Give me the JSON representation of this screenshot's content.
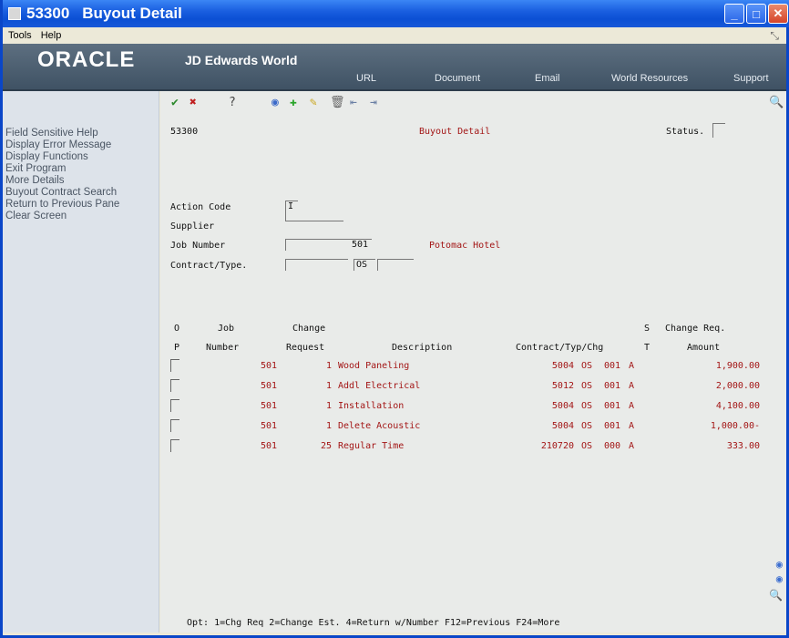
{
  "window": {
    "code": "53300",
    "title": "Buyout Detail",
    "buttons": {
      "minimize": "_",
      "maximize": "□",
      "close": "✕"
    }
  },
  "menu": {
    "tools": "Tools",
    "help": "Help"
  },
  "banner": {
    "logo": "ORACLE",
    "product": "JD Edwards World",
    "links": [
      "URL",
      "Document",
      "Email",
      "World Resources",
      "Support"
    ]
  },
  "left_panel": {
    "items": [
      "Field Sensitive Help",
      "Display Error Message",
      "Display Functions",
      "Exit Program",
      "More Details",
      "Buyout Contract Search",
      "Return to Previous Pane",
      "Clear Screen"
    ]
  },
  "toolbar": {
    "icons": [
      "ok-icon",
      "cancel-icon",
      "help-icon",
      "inquire-icon",
      "add-icon",
      "change-icon",
      "delete-icon",
      "previous-icon",
      "next-icon",
      "search-icon"
    ]
  },
  "form": {
    "program_id": "53300",
    "form_title": "Buyout Detail",
    "status_label": "Status.",
    "status_value": "",
    "action_code_label": "Action Code",
    "action_code_value": "I",
    "supplier_label": "Supplier",
    "supplier_value": "",
    "job_number_label": "Job Number",
    "job_number_value": "501",
    "job_name": "Potomac Hotel",
    "contract_type_label": "Contract/Type.",
    "contract_value": "",
    "type_value": "OS",
    "change_value": ""
  },
  "table": {
    "headers": {
      "op1": "O",
      "op2": "P",
      "job1": "Job",
      "job2": "Number",
      "chg1": "Change",
      "chg2": "Request",
      "desc": "Description",
      "contract": "Contract/Typ/Chg",
      "st1": "S",
      "st2": "T",
      "amt1": "Change Req.",
      "amt2": "Amount"
    },
    "rows": [
      {
        "job": "501",
        "change": "1",
        "description": "Wood Paneling",
        "contract": "5004",
        "typ": "OS",
        "chg": "001",
        "status": "A",
        "amount": "1,900.00"
      },
      {
        "job": "501",
        "change": "1",
        "description": "Addl Electrical",
        "contract": "5012",
        "typ": "OS",
        "chg": "001",
        "status": "A",
        "amount": "2,000.00"
      },
      {
        "job": "501",
        "change": "1",
        "description": "Installation",
        "contract": "5004",
        "typ": "OS",
        "chg": "001",
        "status": "A",
        "amount": "4,100.00"
      },
      {
        "job": "501",
        "change": "1",
        "description": "Delete Acoustic",
        "contract": "5004",
        "typ": "OS",
        "chg": "001",
        "status": "A",
        "amount": "1,000.00-"
      },
      {
        "job": "501",
        "change": "25",
        "description": "Regular Time",
        "contract": "210720",
        "typ": "OS",
        "chg": "000",
        "status": "A",
        "amount": "333.00"
      }
    ]
  },
  "footer": {
    "text": "Opt:  1=Chg Req  2=Change Est.  4=Return w/Number   F12=Previous   F24=More"
  },
  "colors": {
    "title_bar": "#1a5fe0",
    "banner": "#4a5d6f",
    "data_red": "#a31515",
    "left_panel": "#dde3ea",
    "main_bg": "#e9ebe9"
  }
}
